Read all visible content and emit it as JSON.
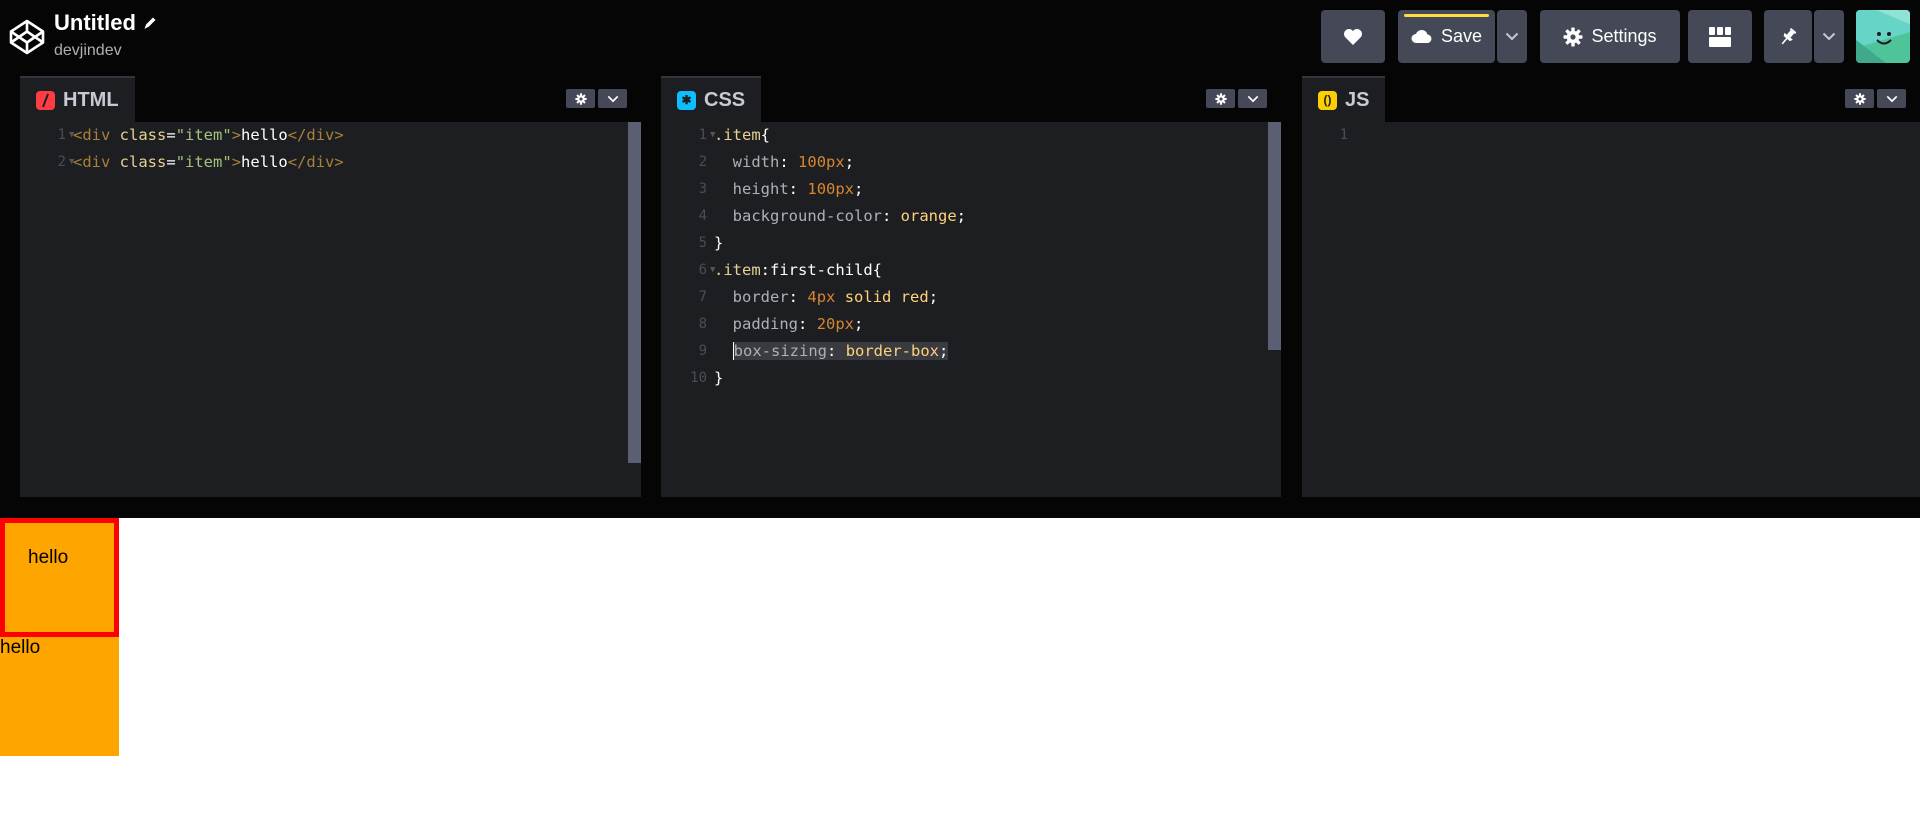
{
  "header": {
    "title": "Untitled",
    "username": "devjindev",
    "save_label": "Save",
    "settings_label": "Settings",
    "icons": [
      "codepen-logo-icon",
      "pencil-icon",
      "heart-icon",
      "cloud-icon",
      "chevron-down-icon",
      "gear-icon",
      "layout-icon",
      "pin-icon",
      "avatar"
    ]
  },
  "editors": {
    "html": {
      "label": "HTML",
      "icon_color": "#ff3c41",
      "lines": [
        {
          "n": "1",
          "html": "<span class='k-tag'>&lt;div</span> <span class='k-attr'>class</span><span class='k-pun'>=</span><span class='k-str'>\"item\"</span><span class='k-tag'>&gt;</span><span class='k-txt'>hello</span><span class='k-tag'>&lt;/div&gt;</span>"
        },
        {
          "n": "2",
          "html": "<span class='k-tag'>&lt;div</span> <span class='k-attr'>class</span><span class='k-pun'>=</span><span class='k-str'>\"item\"</span><span class='k-tag'>&gt;</span><span class='k-txt'>hello</span><span class='k-tag'>&lt;/div&gt;</span>"
        }
      ]
    },
    "css": {
      "label": "CSS",
      "icon_color": "#0ebeff",
      "lines": [
        {
          "n": "1",
          "html": "<span class='k-sel'>.item</span><span class='k-pun'>{</span>"
        },
        {
          "n": "2",
          "html": "  <span class='k-prop'>width</span><span class='k-pun'>:</span> <span class='k-num'>100px</span><span class='k-pun'>;</span>"
        },
        {
          "n": "3",
          "html": "  <span class='k-prop'>height</span><span class='k-pun'>:</span> <span class='k-num'>100px</span><span class='k-pun'>;</span>"
        },
        {
          "n": "4",
          "html": "  <span class='k-prop'>background-color</span><span class='k-pun'>:</span> <span class='k-val'>orange</span><span class='k-pun'>;</span>"
        },
        {
          "n": "5",
          "html": "<span class='k-pun'>}</span>"
        },
        {
          "n": "6",
          "html": "<span class='k-sel'>.item</span><span class='k-pun'>:first-child{</span>"
        },
        {
          "n": "7",
          "html": "  <span class='k-prop'>border</span><span class='k-pun'>:</span> <span class='k-num'>4px</span> <span class='k-val'>solid red</span><span class='k-pun'>;</span>"
        },
        {
          "n": "8",
          "html": "  <span class='k-prop'>padding</span><span class='k-pun'>:</span> <span class='k-num'>20px</span><span class='k-pun'>;</span>"
        },
        {
          "n": "9",
          "html": "  <span class='hl'><span class='cursor'></span><span class='k-prop'>box-sizing</span><span class='k-pun'>:</span> <span class='k-val'>border-box</span><span class='k-pun'>;</span></span>"
        },
        {
          "n": "10",
          "html": "<span class='k-pun'>}</span>"
        }
      ]
    },
    "js": {
      "label": "JS",
      "icon_color": "#fcd000",
      "lines": [
        {
          "n": "1",
          "html": ""
        }
      ]
    }
  },
  "preview": {
    "items": [
      "hello",
      "hello"
    ]
  },
  "colors": {
    "item_background": "orange",
    "first_child_border": "red",
    "save_accent": "#ffdd40"
  }
}
